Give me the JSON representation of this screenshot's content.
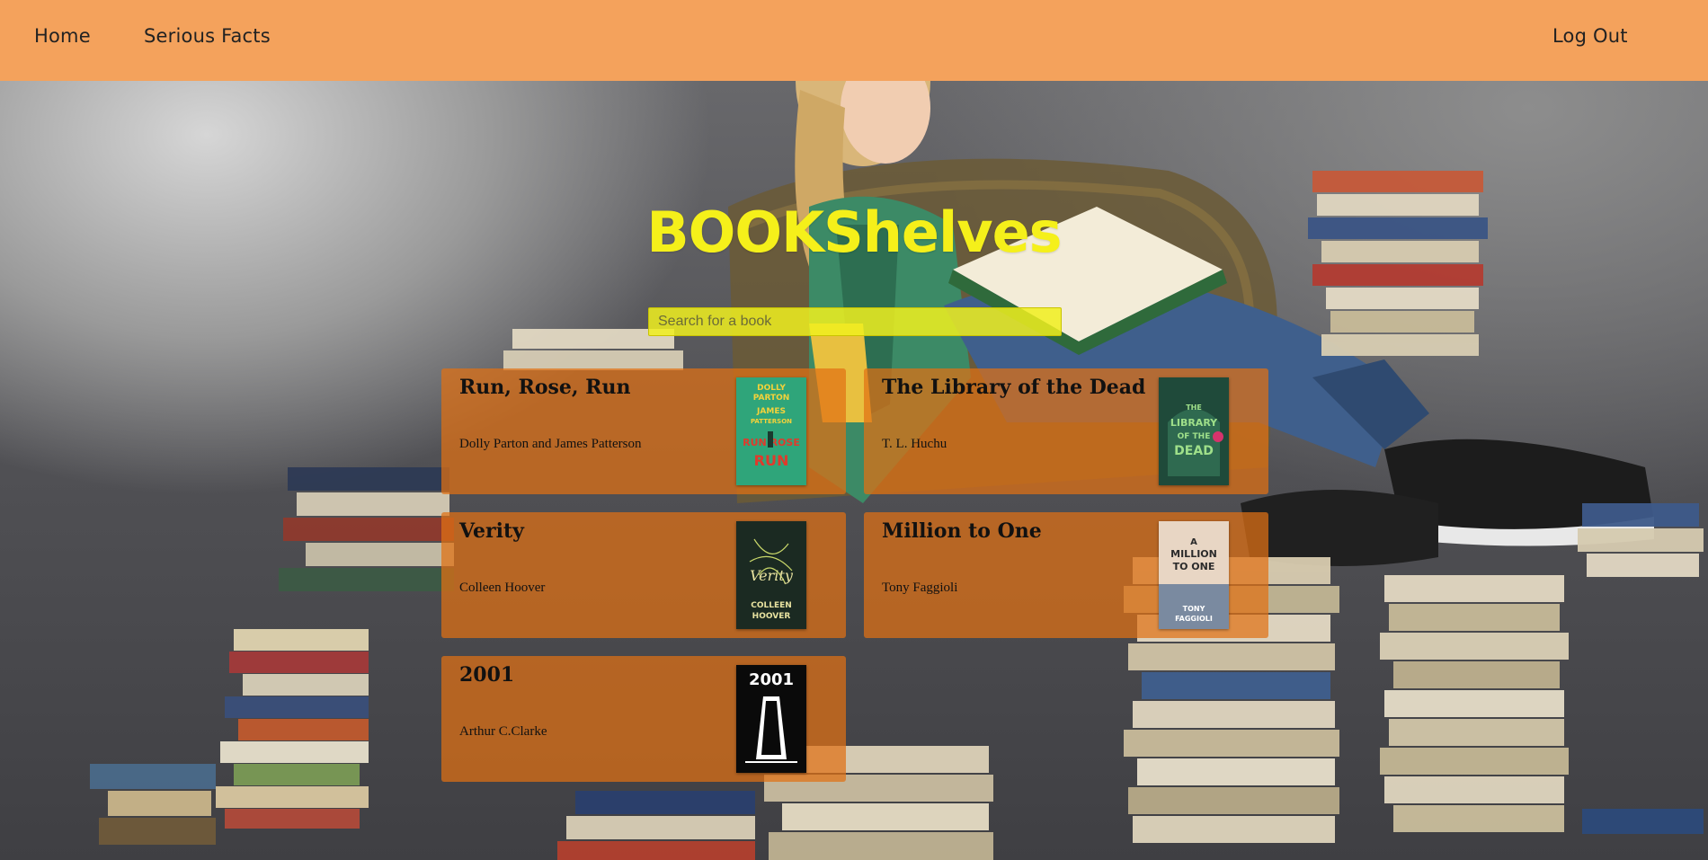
{
  "nav": {
    "home": "Home",
    "serious_facts": "Serious Facts",
    "logout": "Log Out"
  },
  "app": {
    "title": "BOOKShelves"
  },
  "search": {
    "placeholder": "Search for a book",
    "value": ""
  },
  "books": [
    {
      "title": "Run, Rose, Run",
      "author": "Dolly Parton and James Patterson",
      "cover_lines": [
        "DOLLY",
        "PARTON",
        "JAMES",
        "PATTERSON",
        "RUN ROSE",
        "RUN"
      ],
      "cover_color": "#2fa57a"
    },
    {
      "title": "The Library of the Dead",
      "author": "T. L. Huchu",
      "cover_lines": [
        "THE",
        "LIBRARY",
        "OF THE",
        "DEAD"
      ],
      "cover_color": "#1f4a3a"
    },
    {
      "title": "Verity",
      "author": "Colleen Hoover",
      "cover_lines": [
        "Verity",
        "COLLEEN",
        "HOOVER"
      ],
      "cover_color": "#1b2a22"
    },
    {
      "title": "Million to One",
      "author": "Tony Faggioli",
      "cover_lines": [
        "A",
        "MILLION",
        "TO ONE",
        "TONY",
        "FAGGIOLI"
      ],
      "cover_color": "#e8d6c4"
    },
    {
      "title": "2001",
      "author": "Arthur C.Clarke",
      "cover_lines": [
        "2001"
      ],
      "cover_color": "#0a0a0a"
    }
  ],
  "colors": {
    "navbar": "#f4a25c",
    "title": "#f5f01a",
    "card": "#e07014",
    "search": "#f0f01e"
  }
}
